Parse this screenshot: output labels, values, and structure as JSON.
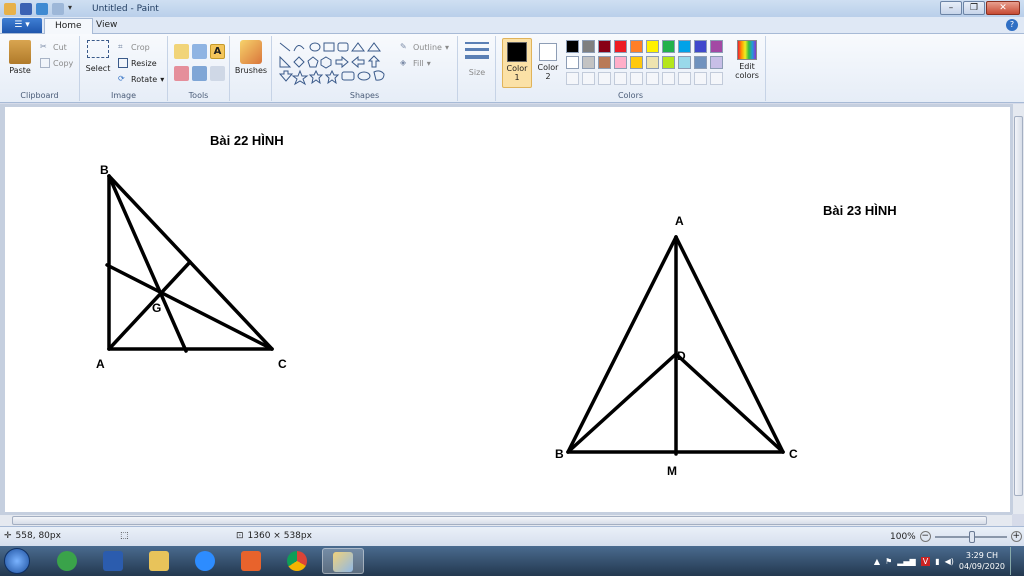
{
  "window": {
    "title": "Untitled - Paint"
  },
  "tabs": {
    "file_label": "",
    "home": "Home",
    "view": "View"
  },
  "ribbon": {
    "clipboard": {
      "label": "Clipboard",
      "paste": "Paste",
      "cut": "Cut",
      "copy": "Copy"
    },
    "image": {
      "label": "Image",
      "select": "Select",
      "crop": "Crop",
      "resize": "Resize",
      "rotate": "Rotate"
    },
    "tools": {
      "label": "Tools"
    },
    "brushes": {
      "label": "Brushes"
    },
    "shapes": {
      "label": "Shapes",
      "outline": "Outline",
      "fill": "Fill"
    },
    "size": {
      "label": "Size"
    },
    "colors": {
      "label": "Colors",
      "color1": "Color 1",
      "color2": "Color 2",
      "edit": "Edit colors",
      "palette_row1": [
        "#000000",
        "#7f7f7f",
        "#880015",
        "#ed1c24",
        "#ff7f27",
        "#fff200",
        "#22b14c",
        "#00a2e8",
        "#3f48cc",
        "#a349a4"
      ],
      "palette_row2": [
        "#ffffff",
        "#c3c3c3",
        "#b97a57",
        "#ffaec9",
        "#ffc90e",
        "#efe4b0",
        "#b5e61d",
        "#99d9ea",
        "#7092be",
        "#c8bfe7"
      ]
    }
  },
  "drawing": {
    "fig22": {
      "title": "Bài 22 HÌNH",
      "B": "B",
      "A": "A",
      "C": "C",
      "G": "G"
    },
    "fig23": {
      "title": "Bài 23 HÌNH",
      "A": "A",
      "B": "B",
      "C": "C",
      "D": "D",
      "M": "M"
    }
  },
  "status": {
    "cursor": "558, 80px",
    "size": "1360 × 538px",
    "zoom": "100%"
  },
  "taskbar": {
    "time": "3:29 CH",
    "date": "04/09/2020"
  }
}
